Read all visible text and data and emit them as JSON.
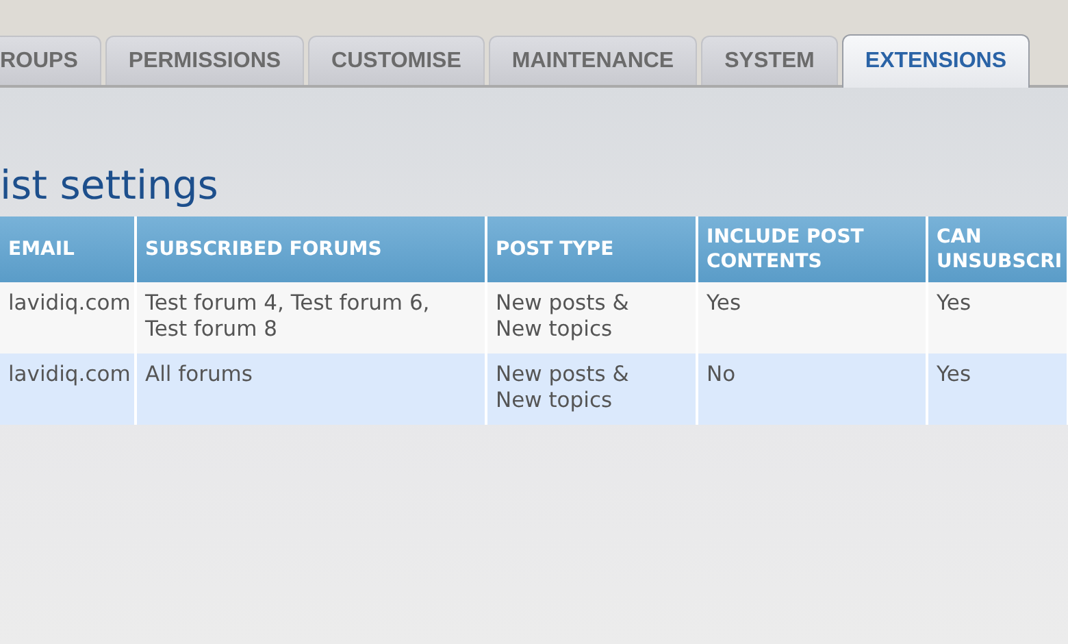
{
  "tabs": [
    {
      "label": "ROUPS",
      "selected": false
    },
    {
      "label": "PERMISSIONS",
      "selected": false
    },
    {
      "label": "CUSTOMISE",
      "selected": false
    },
    {
      "label": "MAINTENANCE",
      "selected": false
    },
    {
      "label": "SYSTEM",
      "selected": false
    },
    {
      "label": "EXTENSIONS",
      "selected": true
    }
  ],
  "page_title": "ist settings",
  "table": {
    "columns": [
      "EMAIL",
      "SUBSCRIBED FORUMS",
      "POST TYPE",
      "INCLUDE POST CONTENTS",
      "CAN UNSUBSCRI"
    ],
    "rows": [
      [
        "lavidiq.com",
        "Test forum 4, Test forum 6, Test forum 8",
        "New posts & New topics",
        "Yes",
        "Yes"
      ],
      [
        "lavidiq.com",
        "All forums",
        "New posts & New topics",
        "No",
        "Yes"
      ]
    ]
  }
}
